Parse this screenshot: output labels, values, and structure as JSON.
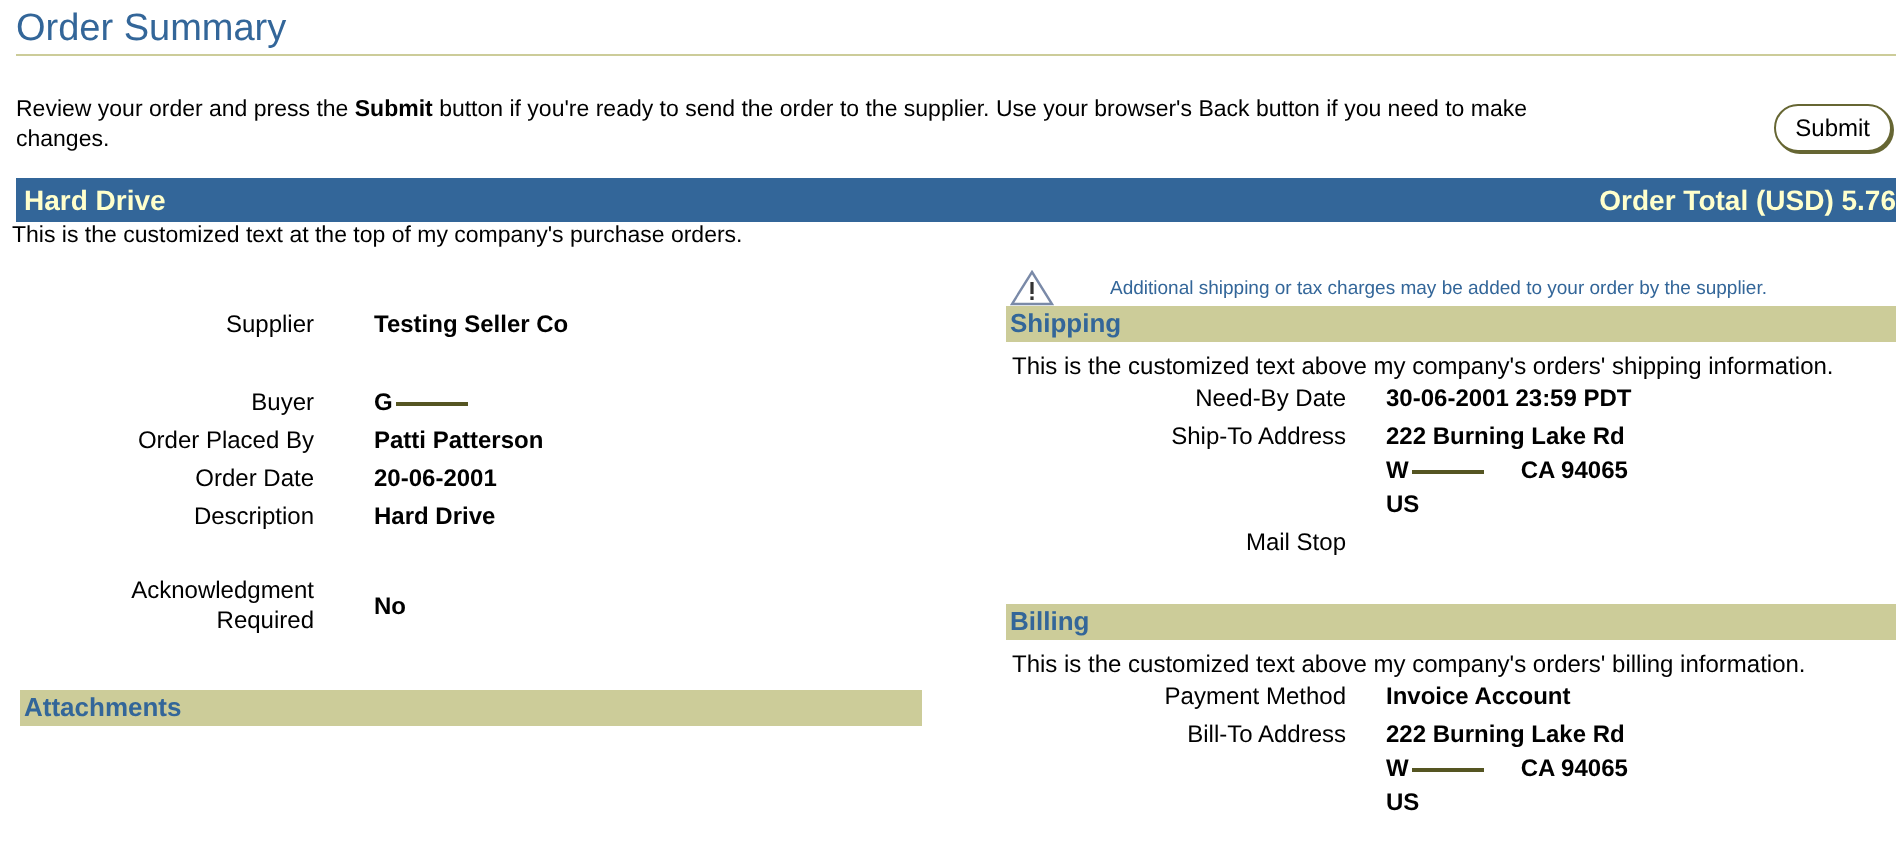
{
  "title": "Order Summary",
  "instruction": "Review your order and press the **Submit** button if you're ready to send the order to the supplier. Use your browser's Back button if you need to make changes.",
  "submit_button": "Submit",
  "header": {
    "name": "Hard Drive",
    "total": "Order Total (USD) 5.76"
  },
  "intro": "This is the customized text at the top of my company's purchase orders.",
  "details": [
    [
      {
        "label": "Supplier",
        "lines": [
          {
            "text": "Testing Seller Co"
          }
        ]
      }
    ],
    [
      {
        "label": "Buyer",
        "lines": [
          {
            "text": "G",
            "redacted": true
          }
        ]
      },
      {
        "label": "Order Placed By",
        "lines": [
          {
            "text": "Patti Patterson"
          }
        ]
      },
      {
        "label": "Order Date",
        "lines": [
          {
            "text": "20-06-2001"
          }
        ]
      },
      {
        "label": "Description",
        "lines": [
          {
            "text": "Hard Drive"
          }
        ]
      }
    ],
    [
      {
        "label": "Acknowledgment Required",
        "lines": [
          {
            "text": "No"
          }
        ]
      }
    ]
  ],
  "attachments": {
    "title": "Attachments"
  },
  "notice": "Additional shipping or tax charges may be added to your order by the supplier.",
  "sections": [
    {
      "title": "Shipping",
      "text": "This is the customized text above my company's orders' shipping information.",
      "fields": [
        {
          "label": "Need-By Date",
          "lines": [
            {
              "text": "30-06-2001 23:59 PDT"
            }
          ]
        },
        {
          "label": "Ship-To Address",
          "lines": [
            {
              "text": "222 Burning Lake Rd"
            },
            {
              "text": "W",
              "redacted": true,
              "after": "CA 94065"
            },
            {
              "text": "US"
            }
          ]
        },
        {
          "label": "Mail Stop"
        }
      ]
    },
    {
      "title": "Billing",
      "text": "This is the customized text above my company's orders' billing information.",
      "fields": [
        {
          "label": "Payment Method",
          "lines": [
            {
              "text": "Invoice Account"
            }
          ]
        },
        {
          "label": "Bill-To Address",
          "lines": [
            {
              "text": "222 Burning Lake Rd"
            },
            {
              "text": "W",
              "redacted": true,
              "after": "CA 94065"
            },
            {
              "text": "US"
            }
          ]
        }
      ]
    }
  ]
}
